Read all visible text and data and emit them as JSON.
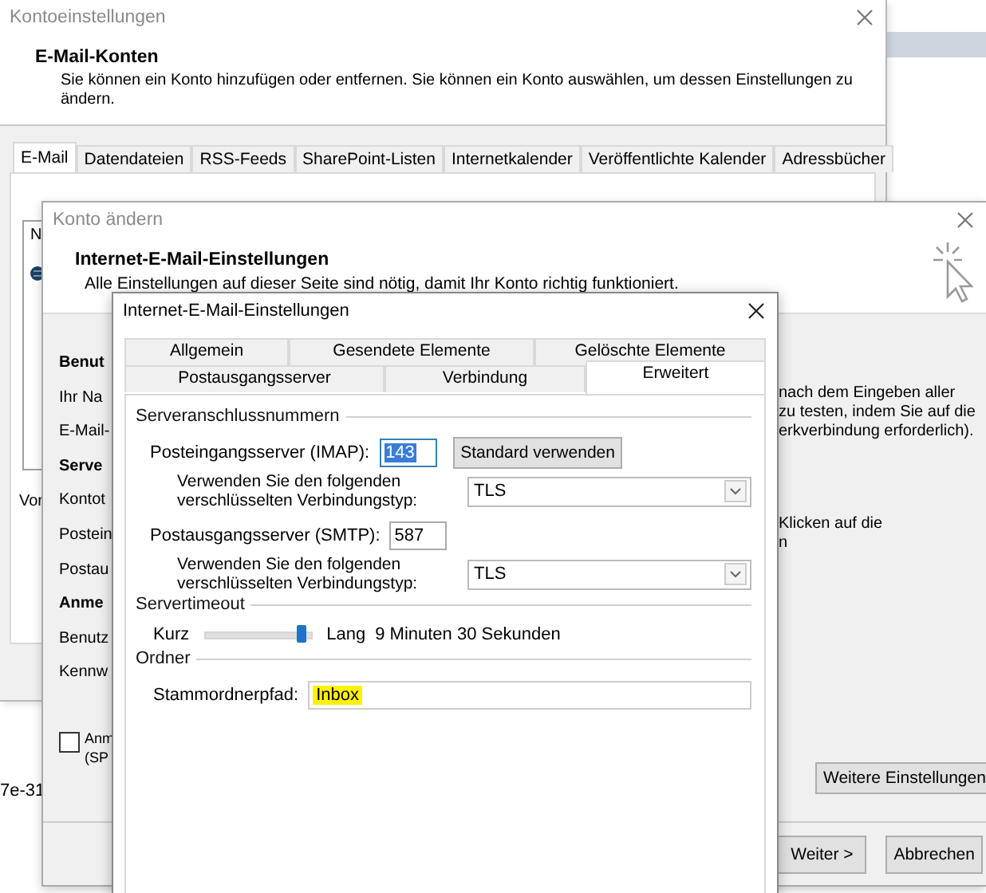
{
  "desktop": {
    "texts": [
      "7e-31"
    ]
  },
  "account_settings": {
    "title": "Kontoeinstellungen",
    "heading": "E-Mail-Konten",
    "description": "Sie können ein Konto hinzufügen oder entfernen. Sie können ein Konto auswählen, um dessen Einstellungen zu ändern.",
    "tabs": [
      {
        "label": "E-Mail",
        "selected": true
      },
      {
        "label": "Datendateien",
        "selected": false
      },
      {
        "label": "RSS-Feeds",
        "selected": false
      },
      {
        "label": "SharePoint-Listen",
        "selected": false
      },
      {
        "label": "Internetkalender",
        "selected": false
      },
      {
        "label": "Veröffentlichte Kalender",
        "selected": false
      },
      {
        "label": "Adressbücher",
        "selected": false
      }
    ],
    "list_items": [
      "N"
    ],
    "note": "Vor"
  },
  "change_account": {
    "title": "Konto ändern",
    "heading": "Internet-E-Mail-Einstellungen",
    "description": "Alle Einstellungen auf dieser Seite sind nötig, damit Ihr Konto richtig funktioniert.",
    "left_items": [
      {
        "kind": "heading",
        "text": "Benut"
      },
      {
        "kind": "label",
        "text": "Ihr Na"
      },
      {
        "kind": "label",
        "text": "E-Mail-"
      },
      {
        "kind": "heading",
        "text": "Serve"
      },
      {
        "kind": "label",
        "text": "Kontot"
      },
      {
        "kind": "label",
        "text": "Postein"
      },
      {
        "kind": "label",
        "text": "Postau"
      },
      {
        "kind": "heading",
        "text": "Anme"
      },
      {
        "kind": "label",
        "text": "Benutz"
      },
      {
        "kind": "label",
        "text": "Kennw"
      }
    ],
    "checkbox": {
      "checked": false,
      "lines": [
        "Anm",
        "(SP"
      ]
    },
    "right_paragraphs": [
      [
        "nach dem Eingeben aller",
        "zu testen, indem Sie auf die",
        "erkverbindung erforderlich)."
      ],
      [
        "Klicken auf die",
        "n"
      ]
    ],
    "more_button": "Weitere Einstellungen",
    "buttons": [
      "Weiter >",
      "Abbrechen"
    ]
  },
  "mail_settings_dialog": {
    "title": "Internet-E-Mail-Einstellungen",
    "tab_rows": [
      [
        {
          "label": "Allgemein",
          "selected": false
        },
        {
          "label": "Gesendete Elemente",
          "selected": false
        },
        {
          "label": "Gelöschte Elemente",
          "selected": false
        }
      ],
      [
        {
          "label": "Postausgangsserver",
          "selected": false
        },
        {
          "label": "Verbindung",
          "selected": false
        },
        {
          "label": "Erweitert",
          "selected": true
        }
      ]
    ],
    "ports": {
      "title": "Serveranschlussnummern",
      "incoming": {
        "label": "Posteingangsserver (IMAP):",
        "value": "143",
        "selected": true
      },
      "default_button": "Standard verwenden",
      "incoming_encryption": {
        "lines": [
          "Verwenden Sie den folgenden",
          "verschlüsselten Verbindungstyp:"
        ],
        "value": "TLS"
      },
      "outgoing": {
        "label": "Postausgangsserver (SMTP):",
        "value": "587",
        "selected": false
      },
      "outgoing_encryption": {
        "lines": [
          "Verwenden Sie den folgenden",
          "verschlüsselten Verbindungstyp:"
        ],
        "value": "TLS"
      }
    },
    "timeout": {
      "title": "Servertimeout",
      "min_label": "Kurz",
      "max_label": "Lang",
      "level": 0.92,
      "reading": "9 Minuten 30 Sekunden"
    },
    "folder": {
      "title": "Ordner",
      "label": "Stammordnerpfad:",
      "value": "Inbox",
      "highlighted": true
    }
  }
}
